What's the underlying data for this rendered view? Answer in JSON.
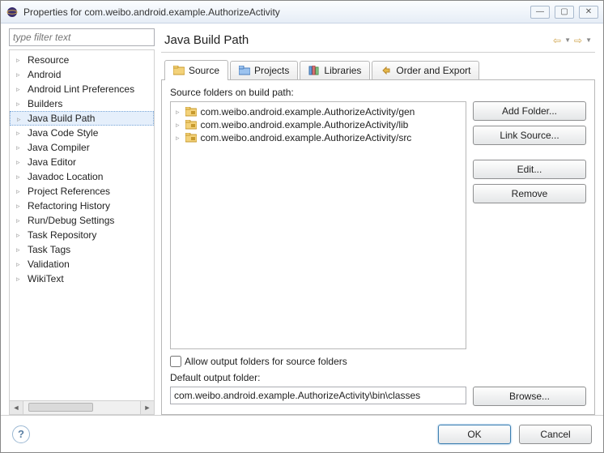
{
  "window": {
    "title": "Properties for com.weibo.android.example.AuthorizeActivity"
  },
  "filter": {
    "placeholder": "type filter text"
  },
  "tree": {
    "items": [
      "Resource",
      "Android",
      "Android Lint Preferences",
      "Builders",
      "Java Build Path",
      "Java Code Style",
      "Java Compiler",
      "Java Editor",
      "Javadoc Location",
      "Project References",
      "Refactoring History",
      "Run/Debug Settings",
      "Task Repository",
      "Task Tags",
      "Validation",
      "WikiText"
    ],
    "selected_index": 4
  },
  "header": {
    "title": "Java Build Path"
  },
  "tabs": [
    {
      "label": "Source"
    },
    {
      "label": "Projects"
    },
    {
      "label": "Libraries"
    },
    {
      "label": "Order and Export"
    }
  ],
  "active_tab_index": 0,
  "source_panel": {
    "label": "Source folders on build path:",
    "folders": [
      "com.weibo.android.example.AuthorizeActivity/gen",
      "com.weibo.android.example.AuthorizeActivity/lib",
      "com.weibo.android.example.AuthorizeActivity/src"
    ],
    "buttons": {
      "add_folder": "Add Folder...",
      "link_source": "Link Source...",
      "edit": "Edit...",
      "remove": "Remove"
    },
    "allow_output": {
      "checked": false,
      "label": "Allow output folders for source folders"
    },
    "default_output_label": "Default output folder:",
    "default_output_value": "com.weibo.android.example.AuthorizeActivity\\bin\\classes",
    "browse": "Browse..."
  },
  "footer": {
    "ok": "OK",
    "cancel": "Cancel"
  }
}
